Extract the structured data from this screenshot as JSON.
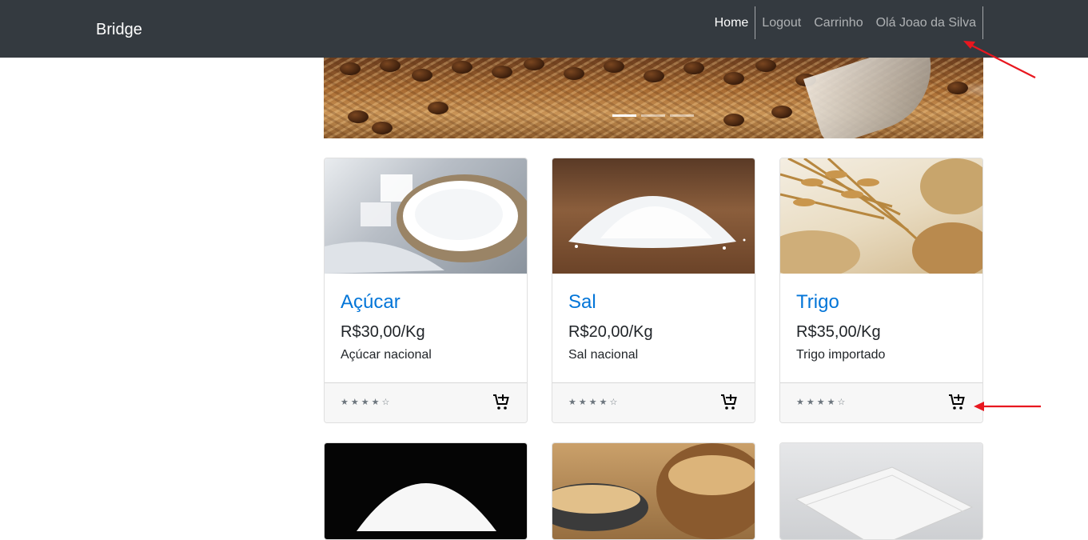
{
  "navbar": {
    "brand": "Bridge",
    "items": [
      {
        "label": "Home",
        "active": true
      },
      {
        "label": "Logout",
        "active": false
      },
      {
        "label": "Carrinho",
        "active": false
      },
      {
        "label": "Olá Joao da Silva",
        "active": false
      }
    ]
  },
  "carousel": {
    "slide_count": 3,
    "active_index": 0
  },
  "products": [
    {
      "name": "Açúcar",
      "price": "R$30,00/Kg",
      "description": "Açúcar nacional",
      "rating_stars": "★★★★☆",
      "rating": 4,
      "image_icon": "sugar-image"
    },
    {
      "name": "Sal",
      "price": "R$20,00/Kg",
      "description": "Sal nacional",
      "rating_stars": "★★★★☆",
      "rating": 4,
      "image_icon": "salt-image"
    },
    {
      "name": "Trigo",
      "price": "R$35,00/Kg",
      "description": "Trigo importado",
      "rating_stars": "★★★★☆",
      "rating": 4,
      "image_icon": "wheat-image"
    }
  ],
  "colors": {
    "navbar_bg": "#343a40",
    "link": "#0275d8",
    "annotation_arrow": "#e8171f"
  }
}
